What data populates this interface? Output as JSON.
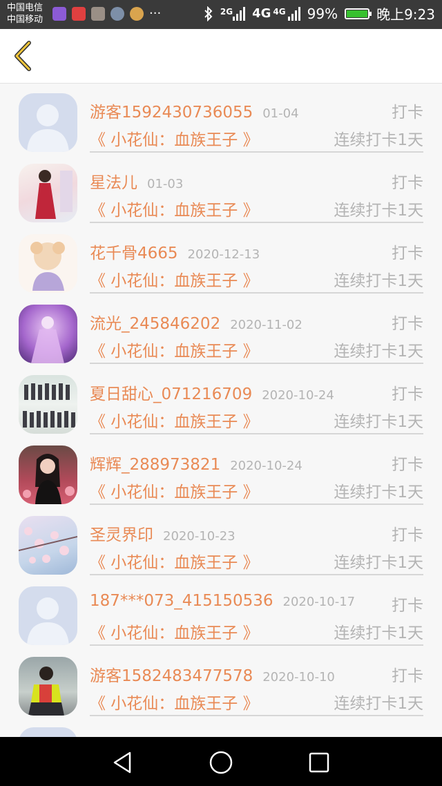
{
  "status_bar": {
    "carrier1": "中国电信",
    "carrier2": "中国移动",
    "signal1_label": "2G",
    "signal2_label": "4G",
    "signal2_sub": "4G",
    "battery": "99%",
    "time": "晚上9:23",
    "notification_icons": [
      "gallery-icon",
      "app-icon",
      "photo-icon",
      "globe-icon",
      "game-icon"
    ],
    "more": "···"
  },
  "header": {
    "back_icon": "chevron-left-icon",
    "accent_color": "#f0c53a"
  },
  "colors": {
    "name": "#e98a55",
    "muted": "#b4b4b4"
  },
  "list": {
    "items": [
      {
        "name": "游客1592430736055",
        "date": "01-04",
        "book": "《 小花仙：血族王子 》",
        "checkin": "打卡",
        "streak": "连续打卡1天",
        "avatar": "default"
      },
      {
        "name": "星法儿",
        "date": "01-03",
        "book": "《 小花仙：血族王子 》",
        "checkin": "打卡",
        "streak": "连续打卡1天",
        "avatar": "red-dress"
      },
      {
        "name": "花千骨4665",
        "date": "2020-12-13",
        "book": "《 小花仙：血族王子 》",
        "checkin": "打卡",
        "streak": "连续打卡1天",
        "avatar": "anime-girl"
      },
      {
        "name": "流光_245846202",
        "date": "2020-11-02",
        "book": "《 小花仙：血族王子 》",
        "checkin": "打卡",
        "streak": "连续打卡1天",
        "avatar": "purple-fairy"
      },
      {
        "name": "夏日甜心_071216709",
        "date": "2020-10-24",
        "book": "《 小花仙：血族王子 》",
        "checkin": "打卡",
        "streak": "连续打卡1天",
        "avatar": "group"
      },
      {
        "name": "辉辉_288973821",
        "date": "2020-10-24",
        "book": "《 小花仙：血族王子 》",
        "checkin": "打卡",
        "streak": "连续打卡1天",
        "avatar": "girl-flowers"
      },
      {
        "name": "圣灵界印",
        "date": "2020-10-23",
        "book": "《 小花仙：血族王子 》",
        "checkin": "打卡",
        "streak": "连续打卡1天",
        "avatar": "blossoms"
      },
      {
        "name": "187***073_415150536",
        "date": "2020-10-17",
        "book": "《 小花仙：血族王子 》",
        "checkin": "打卡",
        "streak": "连续打卡1天",
        "avatar": "default"
      },
      {
        "name": "游客1582483477578",
        "date": "2020-10-10",
        "book": "《 小花仙：血族王子 》",
        "checkin": "打卡",
        "streak": "连续打卡1天",
        "avatar": "yellow-shirt"
      }
    ]
  },
  "nav_bar": {
    "back_icon": "triangle-back-icon",
    "home_icon": "circle-home-icon",
    "recents_icon": "square-recents-icon"
  }
}
